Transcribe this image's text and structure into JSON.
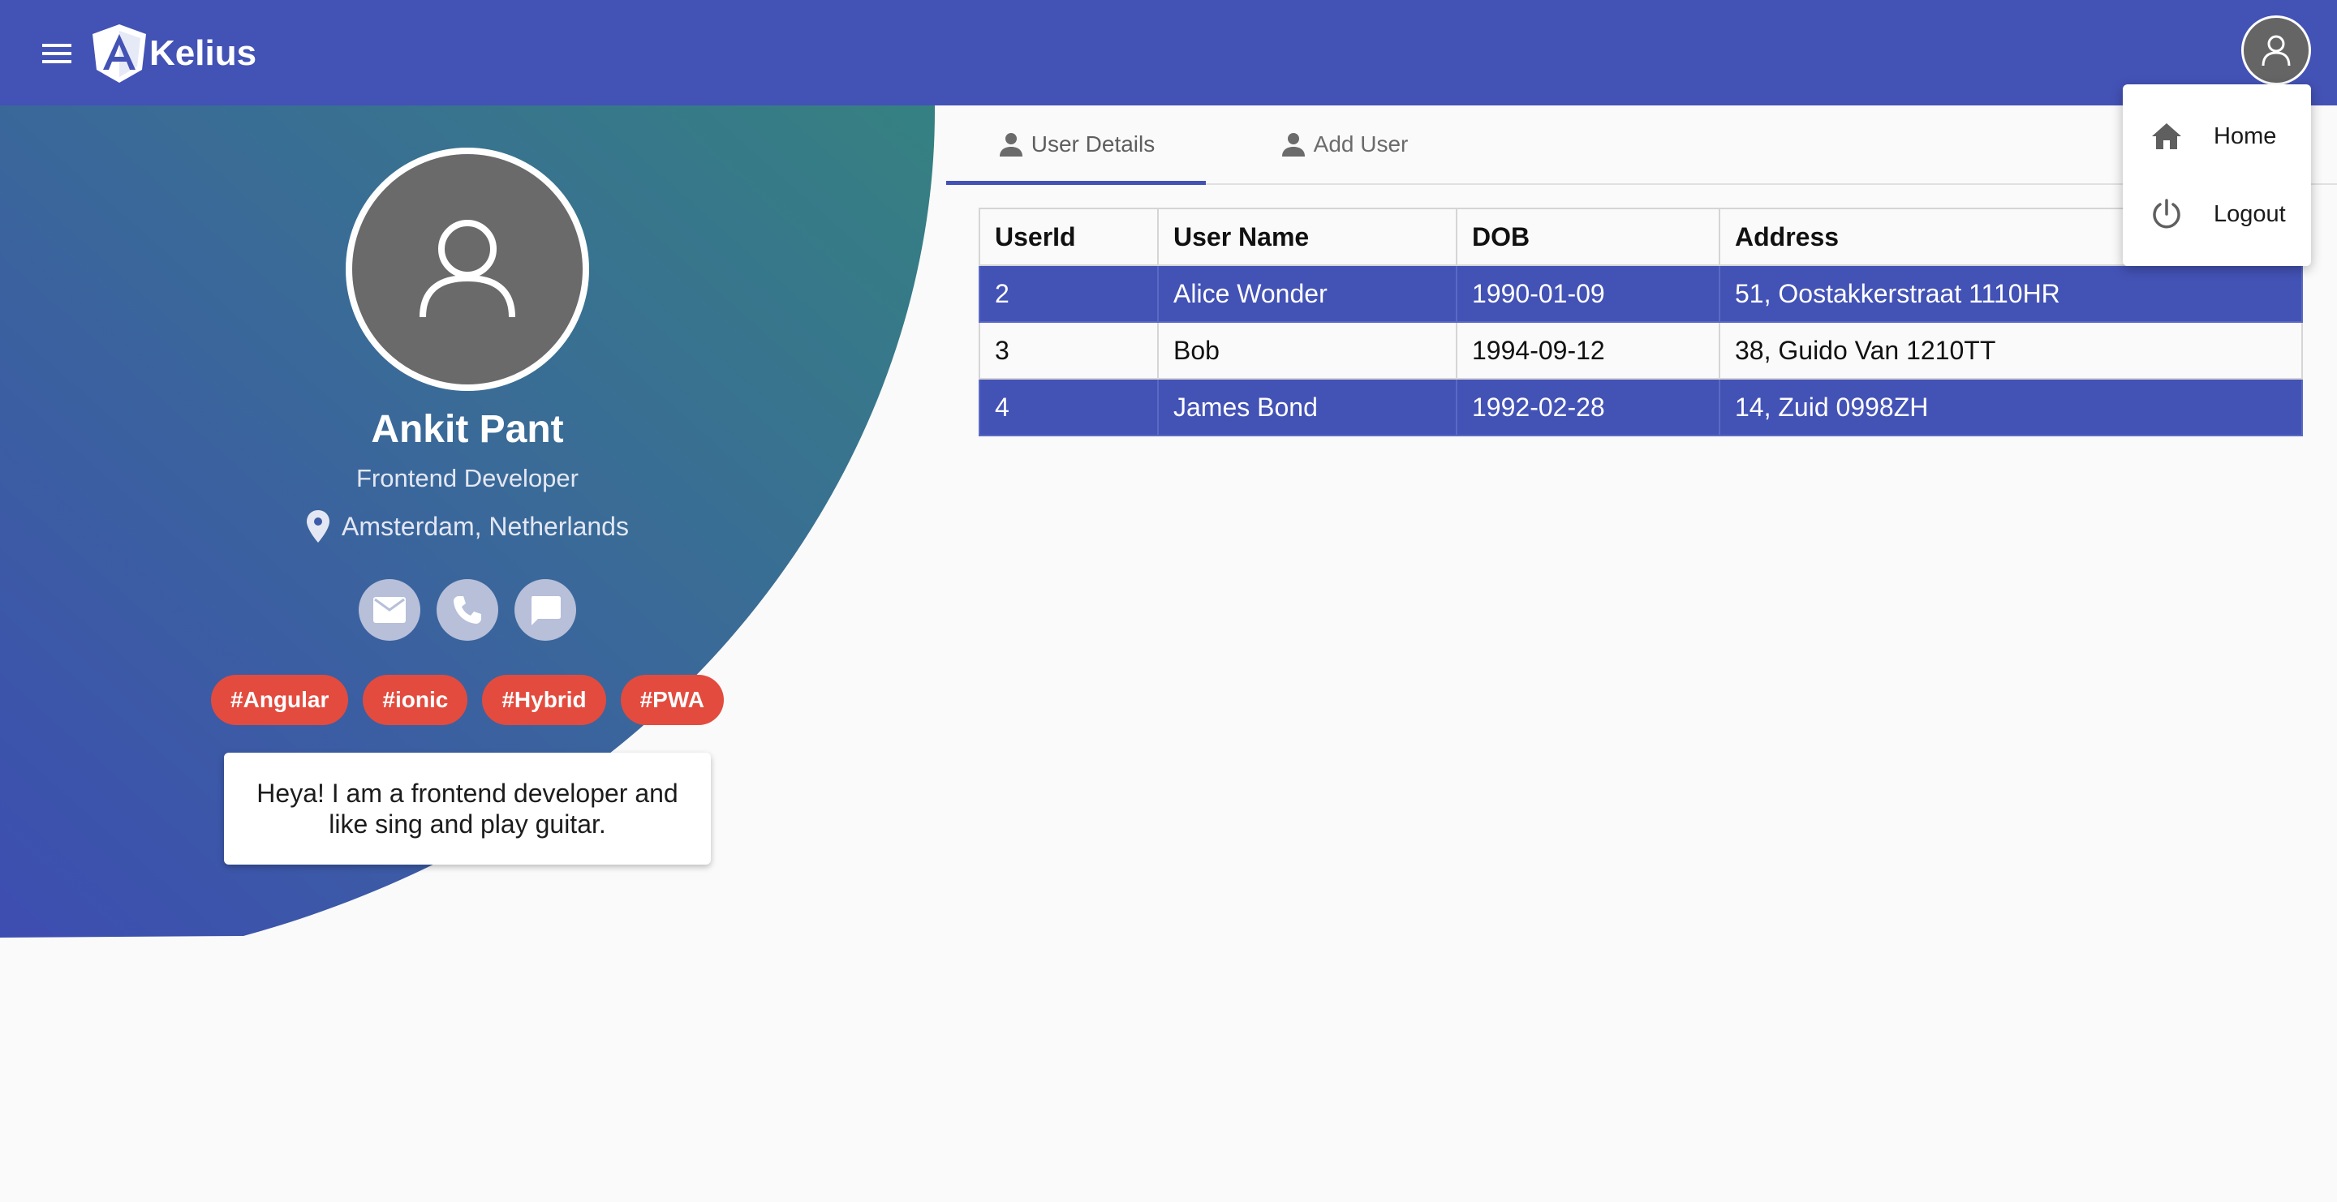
{
  "app": {
    "brand": "Kelius"
  },
  "profile": {
    "name": "Ankit Pant",
    "role": "Frontend Developer",
    "location": "Amsterdam, Netherlands",
    "tags": [
      "#Angular",
      "#ionic",
      "#Hybrid",
      "#PWA"
    ],
    "bio": "Heya! I am a frontend developer and like sing and play guitar."
  },
  "tabs": [
    {
      "label": "User Details",
      "icon": "person-icon",
      "active": true
    },
    {
      "label": "Add User",
      "icon": "person-icon",
      "active": false
    }
  ],
  "table": {
    "columns": [
      "UserId",
      "User Name",
      "DOB",
      "Address"
    ],
    "rows": [
      [
        "2",
        "Alice Wonder",
        "1990-01-09",
        "51, Oostakkerstraat 1110HR"
      ],
      [
        "3",
        "Bob",
        "1994-09-12",
        "38, Guido Van 1210TT"
      ],
      [
        "4",
        "James Bond",
        "1992-02-28",
        "14, Zuid 0998ZH"
      ]
    ]
  },
  "menu": {
    "items": [
      {
        "label": "Home",
        "icon": "home-icon"
      },
      {
        "label": "Logout",
        "icon": "power-icon"
      }
    ]
  },
  "colors": {
    "primary": "#4352b5",
    "gradient_start": "#3a4eb0",
    "gradient_end": "#368383",
    "tag": "#e34b3e",
    "avatar": "#656565"
  }
}
